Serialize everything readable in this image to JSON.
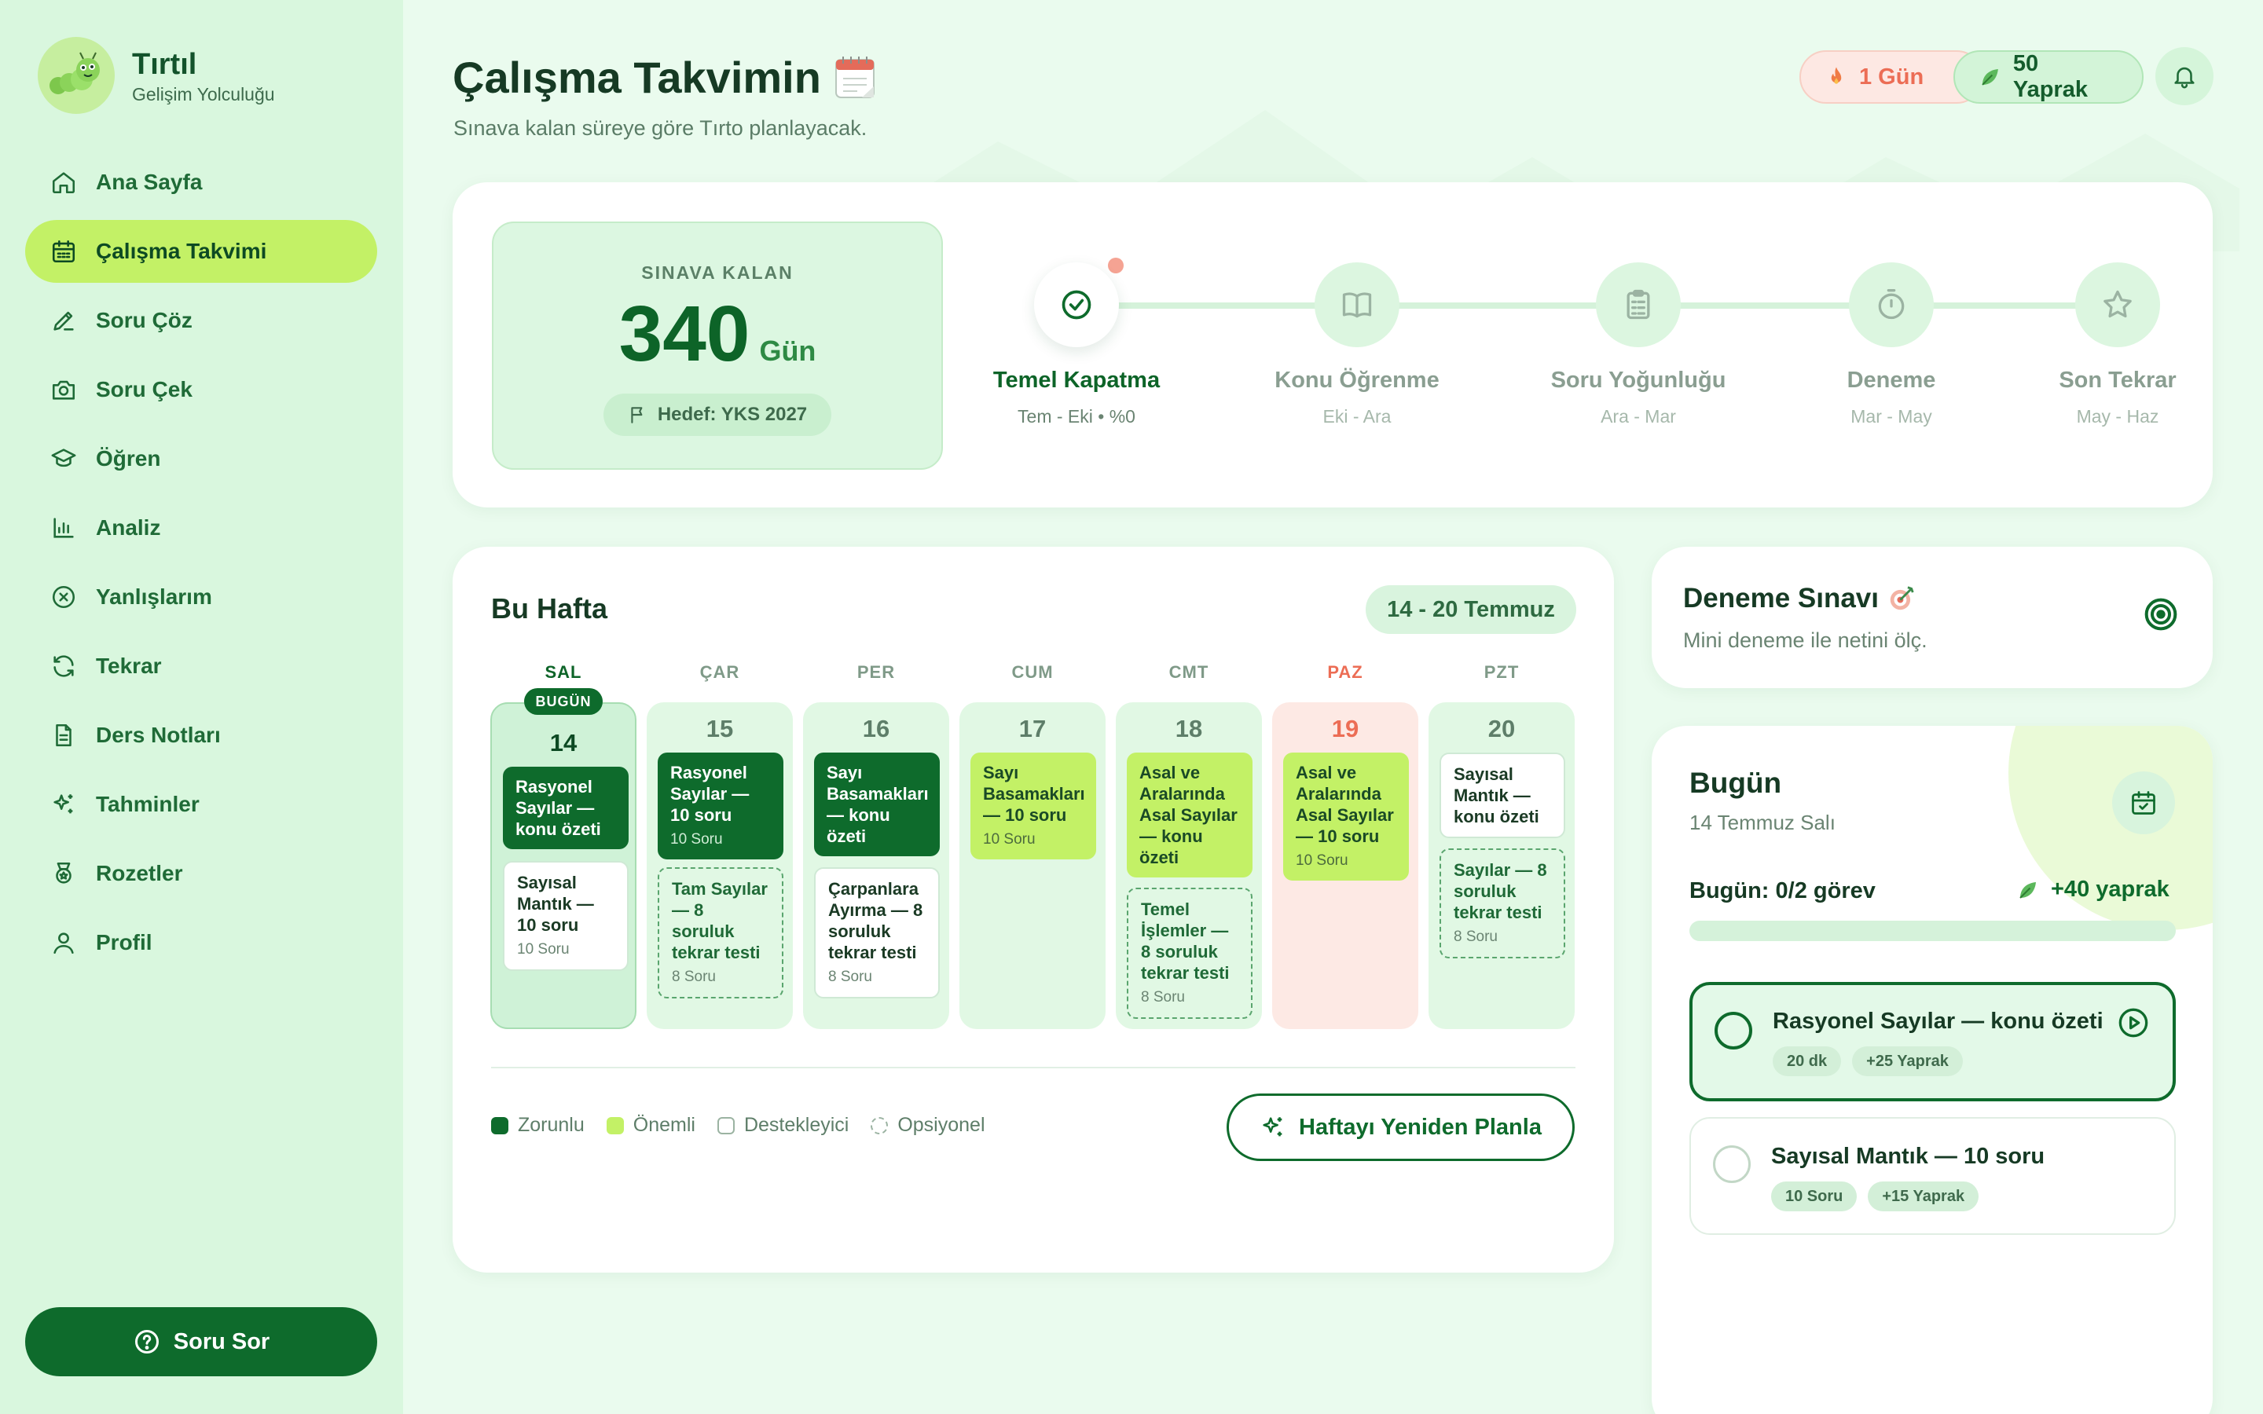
{
  "brand": {
    "name": "Tırtıl",
    "subtitle": "Gelişim Yolculuğu"
  },
  "nav": [
    {
      "label": "Ana Sayfa",
      "icon": "home-icon",
      "active": false
    },
    {
      "label": "Çalışma Takvimi",
      "icon": "calendar-icon",
      "active": true
    },
    {
      "label": "Soru Çöz",
      "icon": "pencil-icon",
      "active": false
    },
    {
      "label": "Soru Çek",
      "icon": "camera-icon",
      "active": false
    },
    {
      "label": "Öğren",
      "icon": "graduation-cap-icon",
      "active": false
    },
    {
      "label": "Analiz",
      "icon": "bar-chart-icon",
      "active": false
    },
    {
      "label": "Yanlışlarım",
      "icon": "x-circle-icon",
      "active": false
    },
    {
      "label": "Tekrar",
      "icon": "refresh-icon",
      "active": false
    },
    {
      "label": "Ders Notları",
      "icon": "document-icon",
      "active": false
    },
    {
      "label": "Tahminler",
      "icon": "sparkles-icon",
      "active": false
    },
    {
      "label": "Rozetler",
      "icon": "badge-icon",
      "active": false
    },
    {
      "label": "Profil",
      "icon": "user-icon",
      "active": false
    }
  ],
  "ask_button": "Soru Sor",
  "header": {
    "title": "Çalışma Takvimin",
    "subtitle": "Sınava kalan süreye göre Tırto planlayacak.",
    "streak": "1 Gün",
    "leaves": "50 Yaprak"
  },
  "countdown": {
    "label": "SINAVA KALAN",
    "days": "340",
    "unit": "Gün",
    "goal": "Hedef: YKS 2027"
  },
  "phases": [
    {
      "name": "Temel Kapatma",
      "range": "Tem - Eki • %0",
      "icon": "check-circle-icon",
      "active": true
    },
    {
      "name": "Konu Öğrenme",
      "range": "Eki - Ara",
      "icon": "book-open-icon",
      "active": false
    },
    {
      "name": "Soru Yoğunluğu",
      "range": "Ara - Mar",
      "icon": "clipboard-icon",
      "active": false
    },
    {
      "name": "Deneme",
      "range": "Mar - May",
      "icon": "stopwatch-icon",
      "active": false
    },
    {
      "name": "Son Tekrar",
      "range": "May - Haz",
      "icon": "star-icon",
      "active": false
    }
  ],
  "week": {
    "title": "Bu Hafta",
    "range": "14 - 20 Temmuz",
    "today_badge": "BUGÜN",
    "days": [
      {
        "abbr": "SAL",
        "num": "14",
        "tasks": [
          {
            "title": "Rasyonel Sayılar — konu özeti",
            "sub": "",
            "kind": "zorunlu"
          },
          {
            "title": "Sayısal Mantık — 10 soru",
            "sub": "10 Soru",
            "kind": "destekleyici"
          }
        ]
      },
      {
        "abbr": "ÇAR",
        "num": "15",
        "tasks": [
          {
            "title": "Rasyonel Sayılar — 10 soru",
            "sub": "10 Soru",
            "kind": "zorunlu"
          },
          {
            "title": "Tam Sayılar — 8 soruluk tekrar testi",
            "sub": "8 Soru",
            "kind": "opsiyonel"
          }
        ]
      },
      {
        "abbr": "PER",
        "num": "16",
        "tasks": [
          {
            "title": "Sayı Basamakları — konu özeti",
            "sub": "",
            "kind": "zorunlu"
          },
          {
            "title": "Çarpanlara Ayırma — 8 soruluk tekrar testi",
            "sub": "8 Soru",
            "kind": "destekleyici"
          }
        ]
      },
      {
        "abbr": "CUM",
        "num": "17",
        "tasks": [
          {
            "title": "Sayı Basamakları — 10 soru",
            "sub": "10 Soru",
            "kind": "onemli"
          }
        ]
      },
      {
        "abbr": "CMT",
        "num": "18",
        "tasks": [
          {
            "title": "Asal ve Aralarında Asal Sayılar — konu özeti",
            "sub": "",
            "kind": "onemli"
          },
          {
            "title": "Temel İşlemler — 8 soruluk tekrar testi",
            "sub": "8 Soru",
            "kind": "opsiyonel"
          }
        ]
      },
      {
        "abbr": "PAZ",
        "num": "19",
        "tasks": [
          {
            "title": "Asal ve Aralarında Asal Sayılar — 10 soru",
            "sub": "10 Soru",
            "kind": "onemli"
          }
        ]
      },
      {
        "abbr": "PZT",
        "num": "20",
        "tasks": [
          {
            "title": "Sayısal Mantık — konu özeti",
            "sub": "",
            "kind": "destekleyici"
          },
          {
            "title": "Sayılar — 8 soruluk tekrar testi",
            "sub": "8 Soru",
            "kind": "opsiyonel"
          }
        ]
      }
    ],
    "legend": [
      "Zorunlu",
      "Önemli",
      "Destekleyici",
      "Opsiyonel"
    ],
    "replan": "Haftayı Yeniden Planla"
  },
  "deneme": {
    "title": "Deneme Sınavı",
    "subtitle": "Mini deneme ile netini ölç."
  },
  "today": {
    "title": "Bugün",
    "date": "14 Temmuz Salı",
    "progress_label": "Bugün: 0/2 görev",
    "reward": "+40 yaprak",
    "progress": 0,
    "tasks": [
      {
        "name": "Rasyonel Sayılar — konu özeti",
        "tags": [
          "20 dk",
          "+25 Yaprak"
        ],
        "active": true
      },
      {
        "name": "Sayısal Mantık — 10 soru",
        "tags": [
          "10 Soru",
          "+15 Yaprak"
        ],
        "active": false
      }
    ]
  },
  "colors": {
    "primary": "#0e6b2c",
    "lime": "#c3f166",
    "accent_red": "#ec6d55",
    "background": "#eafbee"
  }
}
